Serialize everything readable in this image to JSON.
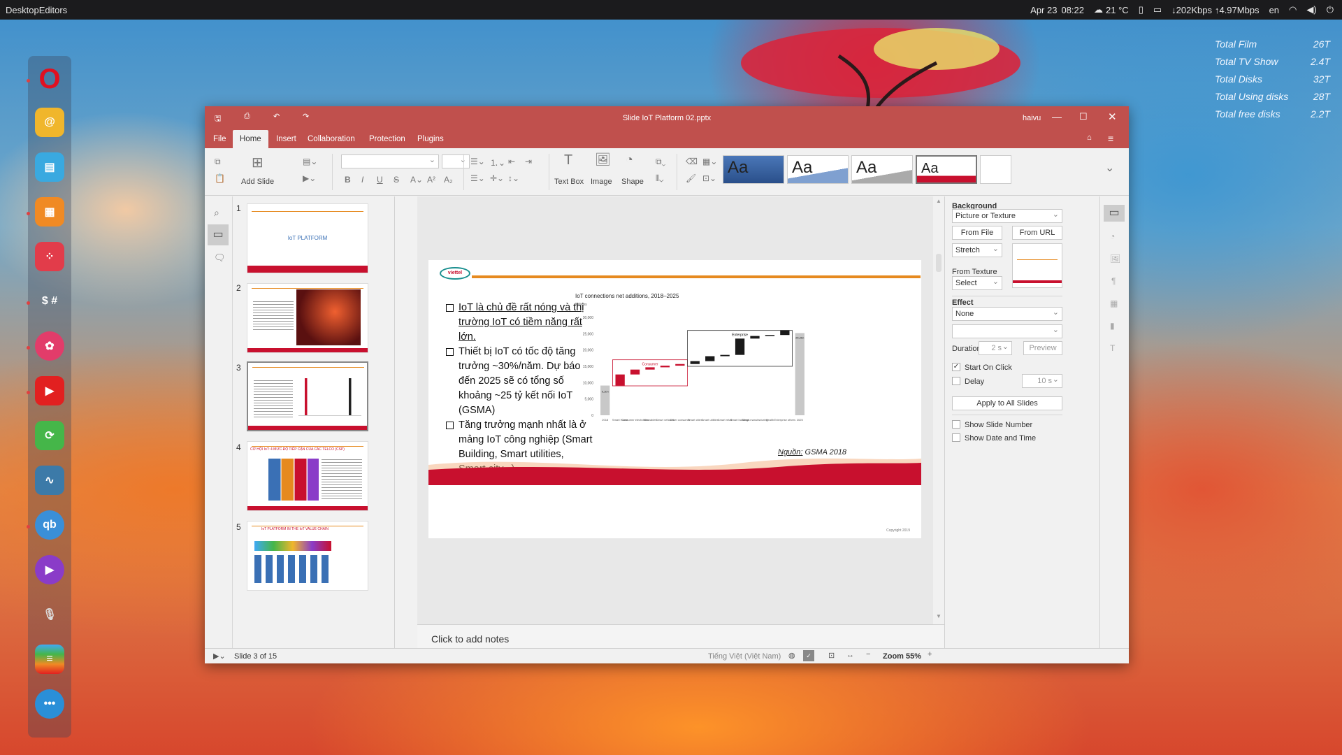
{
  "desktop": {
    "app_name": "DesktopEditors",
    "date": "Apr 23",
    "time": "08:22",
    "weather": "21 °C",
    "net_down": "↓202Kbps",
    "net_up": "↑4.97Mbps",
    "lang": "en"
  },
  "stats": [
    {
      "label": "Total Film",
      "value": "26T"
    },
    {
      "label": "Total TV Show",
      "value": "2.4T"
    },
    {
      "label": "Total Disks",
      "value": "32T"
    },
    {
      "label": "Total Using disks",
      "value": "28T"
    },
    {
      "label": "Total free disks",
      "value": "2.2T"
    }
  ],
  "dock": [
    "opera-icon",
    "mail-icon",
    "files-icon",
    "archive-icon",
    "dashboard-icon",
    "terminal-icon",
    "launcher-icon",
    "youtube-icon",
    "update-icon",
    "monitor-icon",
    "qbittorrent-icon",
    "media-player-icon",
    "microphone-icon",
    "layers-icon",
    "more-apps-icon"
  ],
  "window": {
    "title": "Slide IoT Platform 02.pptx",
    "user": "haivu"
  },
  "menu": [
    "File",
    "Home",
    "Insert",
    "Collaboration",
    "Protection",
    "Plugins"
  ],
  "ribbon": {
    "add_slide": "Add Slide",
    "text_box": "Text Box",
    "image": "Image",
    "shape": "Shape",
    "theme_label": "Aa"
  },
  "thumbs": [
    {
      "num": "1",
      "text": "IoT PLATFORM"
    },
    {
      "num": "2",
      "text": ""
    },
    {
      "num": "3",
      "text": ""
    },
    {
      "num": "4",
      "text": "CƠ HỘI IoT: 4 MỨC ĐỘ TIẾP CẬN CỦA CÁC TELCO (CSP)"
    },
    {
      "num": "5",
      "text": "IoT PLATFORM IN THE IoT VALUE CHAIN"
    }
  ],
  "slide": {
    "bullets": [
      "IoT là chủ đề rất nóng và thị trường IoT có tiềm năng rất lớn.",
      "Thiết bị IoT có tốc độ tăng trưởng ~30%/năm. Dự báo đến 2025 sẽ có tổng số khoảng ~25 tỷ kết nối IoT (GSMA)",
      "Tăng trưởng mạnh nhất là ở mảng IoT công nghiệp (Smart Building, Smart utilities, Smart city...)"
    ],
    "source_label": "Nguồn:",
    "source_text": " GSMA 2018",
    "copyright": "Copyright 2019",
    "logo_text": "viettel"
  },
  "chart_data": {
    "type": "bar",
    "title": "IoT connections net additions, 2018–2025",
    "ylabel": "Millions",
    "ylim": [
      0,
      30000
    ],
    "yticks": [
      "30,000",
      "25,000",
      "20,000",
      "15,000",
      "10,000",
      "5,000",
      "0"
    ],
    "categories": [
      "2018",
      "Smart Home",
      "Consumer electronics",
      "Wearables",
      "Smart vehicles",
      "Other consumer",
      "Smart cities",
      "Smart utilities",
      "Smart retail",
      "Smart buildings",
      "Smart manufacturing",
      "Health",
      "Enterprise others",
      "2025"
    ],
    "values": [
      9100,
      3400,
      1500,
      700,
      500,
      500,
      900,
      1500,
      400,
      5000,
      800,
      300,
      1500,
      25200
    ],
    "labels": {
      "start": "9,1bn",
      "end": "25,2bn"
    },
    "groups": [
      "Consumer",
      "Enterprise"
    ]
  },
  "notes": {
    "placeholder": "Click to add notes"
  },
  "panel": {
    "background": "Background",
    "fill": "Picture or Texture",
    "from_file": "From File",
    "from_url": "From URL",
    "stretch": "Stretch",
    "from_texture": "From Texture",
    "select": "Select",
    "effect": "Effect",
    "effect_value": "None",
    "duration": "Duration",
    "duration_value": "2 s",
    "preview": "Preview",
    "start_on_click": "Start On Click",
    "delay": "Delay",
    "delay_value": "10 s",
    "apply_all": "Apply to All Slides",
    "show_slide_number": "Show Slide Number",
    "show_date_time": "Show Date and Time"
  },
  "status": {
    "slide_info": "Slide 3 of 15",
    "language": "Tiếng Việt (Việt Nam)",
    "zoom": "Zoom 55%"
  },
  "colors": {
    "accent": "#c0504d",
    "slide_red": "#c8102e",
    "orange": "#e68a1f"
  }
}
